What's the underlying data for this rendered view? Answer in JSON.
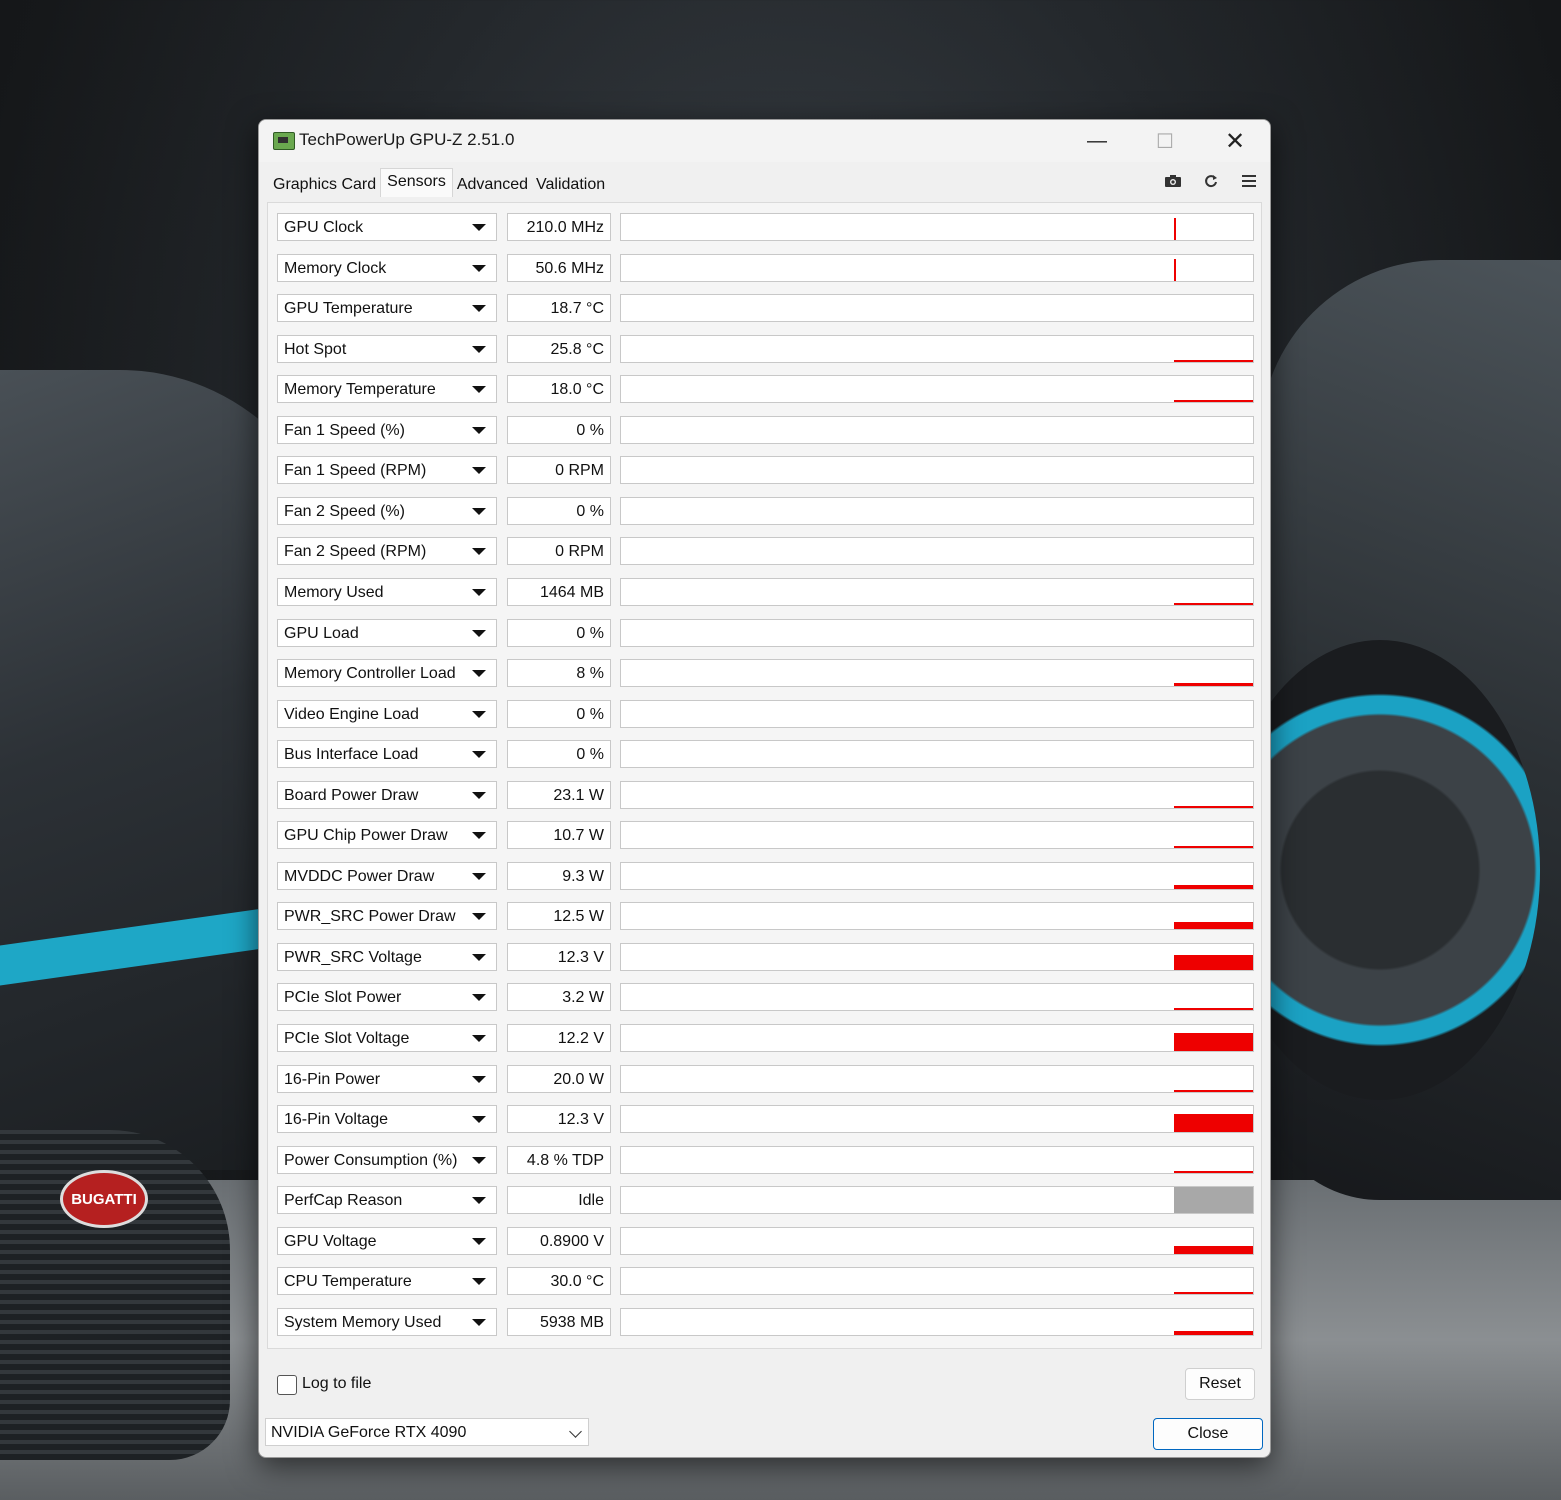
{
  "window": {
    "title": "TechPowerUp GPU-Z 2.51.0",
    "controls": {
      "minimize": "—",
      "maximize": "☐",
      "close": "✕"
    }
  },
  "tabs": [
    "Graphics Card",
    "Sensors",
    "Advanced",
    "Validation"
  ],
  "active_tab": "Sensors",
  "toolbar_icons": [
    "camera-icon",
    "refresh-icon",
    "menu-icon"
  ],
  "background_badge": "BUGATTI",
  "sensors": [
    {
      "name": "GPU Clock",
      "value": "210.0 MHz",
      "trace_level": 0.8,
      "trace_width_frac": 0.03
    },
    {
      "name": "Memory Clock",
      "value": "50.6 MHz",
      "trace_level": 0.8,
      "trace_width_frac": 0.03
    },
    {
      "name": "GPU Temperature",
      "value": "18.7 °C",
      "trace_level": 0.0
    },
    {
      "name": "Hot Spot",
      "value": "25.8 °C",
      "trace_level": 0.05
    },
    {
      "name": "Memory Temperature",
      "value": "18.0 °C",
      "trace_level": 0.05
    },
    {
      "name": "Fan 1 Speed (%)",
      "value": "0 %",
      "trace_level": 0
    },
    {
      "name": "Fan 1 Speed (RPM)",
      "value": "0 RPM",
      "trace_level": 0
    },
    {
      "name": "Fan 2 Speed (%)",
      "value": "0 %",
      "trace_level": 0
    },
    {
      "name": "Fan 2 Speed (RPM)",
      "value": "0 RPM",
      "trace_level": 0
    },
    {
      "name": "Memory Used",
      "value": "1464 MB",
      "trace_level": 0.05
    },
    {
      "name": "GPU Load",
      "value": "0 %",
      "trace_level": 0
    },
    {
      "name": "Memory Controller Load",
      "value": "8 %",
      "trace_level": 0.1
    },
    {
      "name": "Video Engine Load",
      "value": "0 %",
      "trace_level": 0
    },
    {
      "name": "Bus Interface Load",
      "value": "0 %",
      "trace_level": 0
    },
    {
      "name": "Board Power Draw",
      "value": "23.1 W",
      "trace_level": 0.05
    },
    {
      "name": "GPU Chip Power Draw",
      "value": "10.7 W",
      "trace_level": 0.05
    },
    {
      "name": "MVDDC Power Draw",
      "value": "9.3 W",
      "trace_level": 0.15
    },
    {
      "name": "PWR_SRC Power Draw",
      "value": "12.5 W",
      "trace_level": 0.25
    },
    {
      "name": "PWR_SRC Voltage",
      "value": "12.3 V",
      "trace_level": 0.55
    },
    {
      "name": "PCIe Slot Power",
      "value": "3.2 W",
      "trace_level": 0.05
    },
    {
      "name": "PCIe Slot Voltage",
      "value": "12.2 V",
      "trace_level": 0.65
    },
    {
      "name": "16-Pin Power",
      "value": "20.0 W",
      "trace_level": 0.05
    },
    {
      "name": "16-Pin Voltage",
      "value": "12.3 V",
      "trace_level": 0.65
    },
    {
      "name": "Power Consumption (%)",
      "value": "4.8 % TDP",
      "trace_level": 0.05
    },
    {
      "name": "PerfCap Reason",
      "value": "Idle",
      "trace_level": 1.0,
      "trace_gray": true
    },
    {
      "name": "GPU Voltage",
      "value": "0.8900 V",
      "trace_level": 0.3
    },
    {
      "name": "CPU Temperature",
      "value": "30.0 °C",
      "trace_level": 0.05
    },
    {
      "name": "System Memory Used",
      "value": "5938 MB",
      "trace_level": 0.15
    }
  ],
  "footer": {
    "log_label": "Log to file",
    "log_checked": false,
    "reset_label": "Reset",
    "gpu_select": "NVIDIA GeForce RTX 4090",
    "close_label": "Close"
  }
}
